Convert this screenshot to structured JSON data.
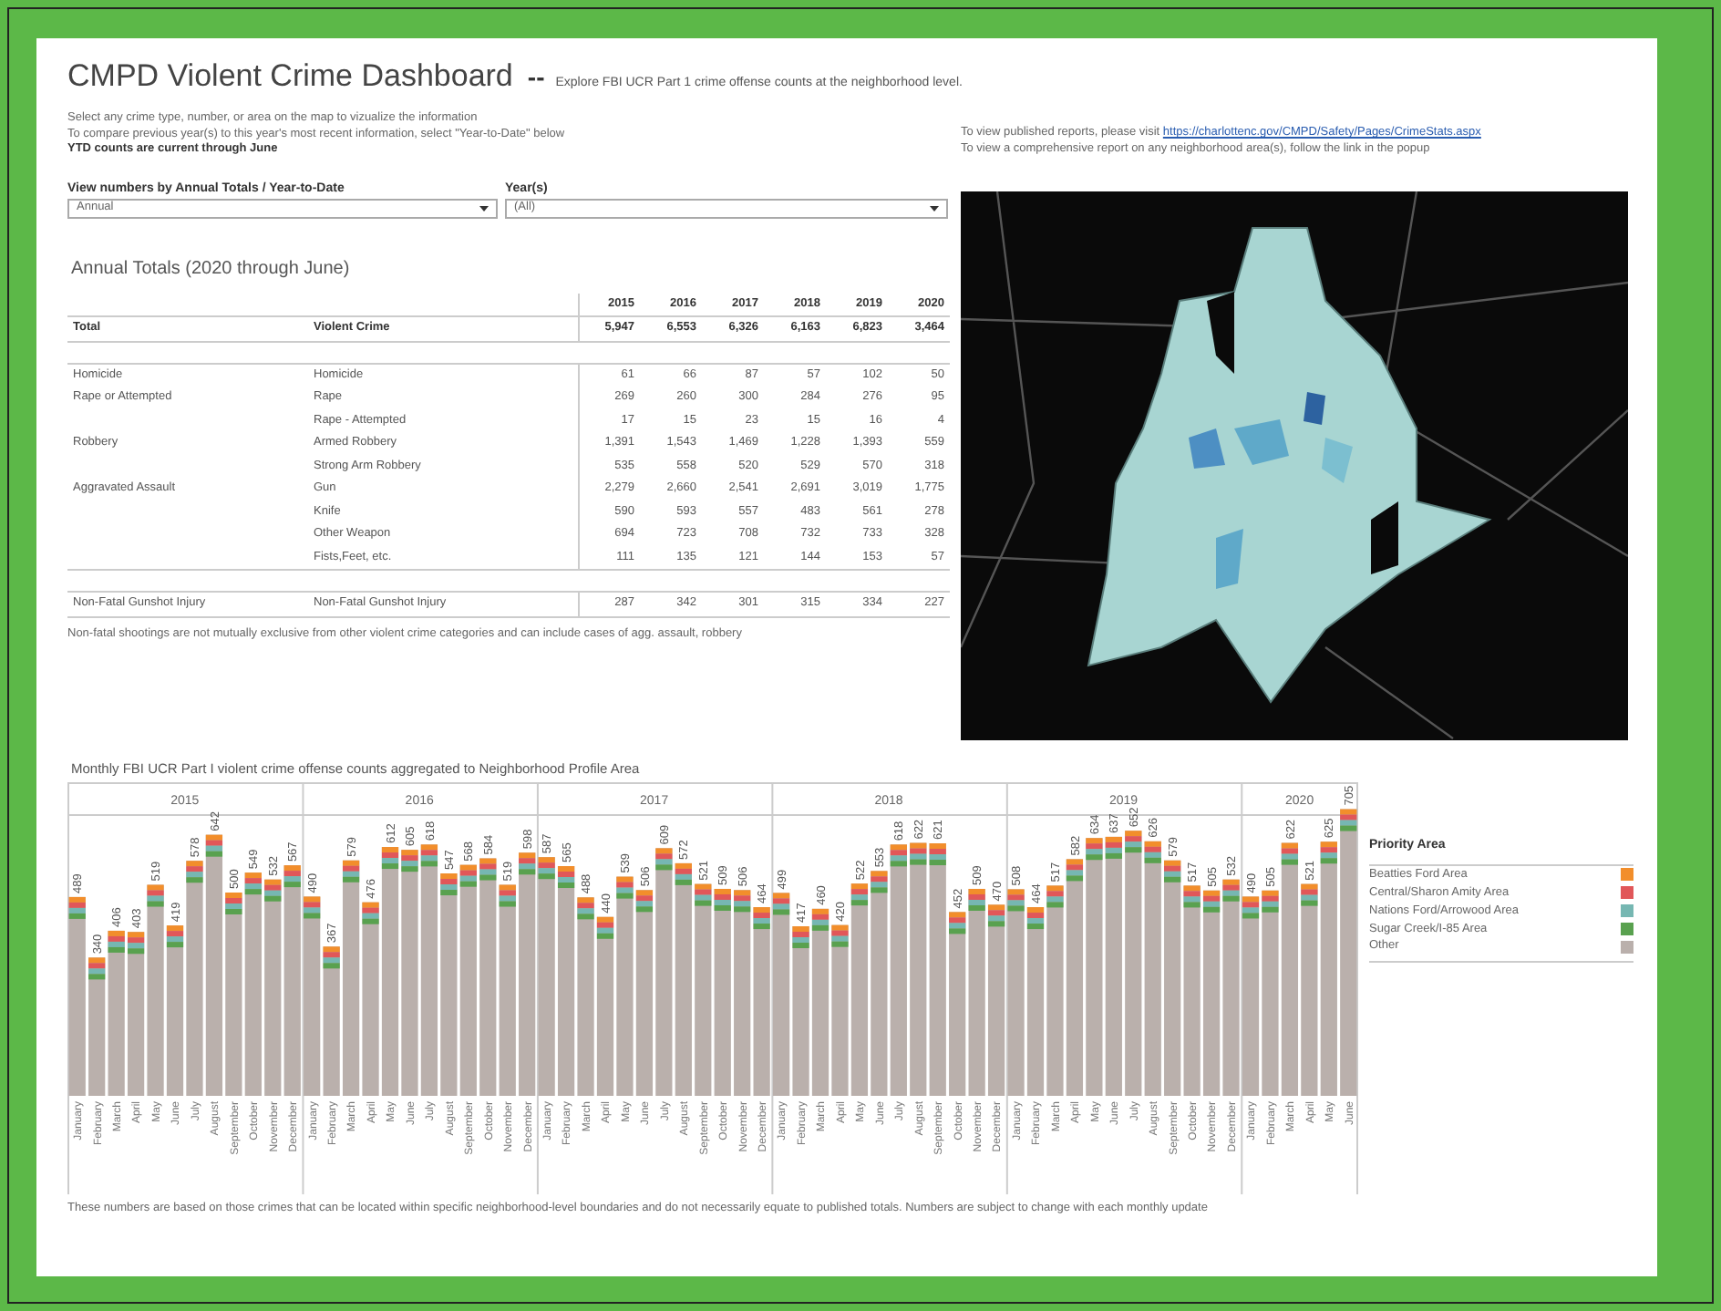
{
  "header": {
    "title": "CMPD Violent Crime Dashboard",
    "separator": "--",
    "subtitle": "Explore FBI UCR Part 1 crime offense counts at the neighborhood level."
  },
  "info_lines": [
    "Select any crime type, number, or area on the map to vizualize the information",
    "To compare previous year(s) to this year's most recent information, select \"Year-to-Date\" below"
  ],
  "ytd_note": "YTD counts are current through June",
  "filters": [
    {
      "label": "View numbers by Annual Totals / Year-to-Date",
      "value": "Annual"
    },
    {
      "label": "Year(s)",
      "value": "(All)"
    }
  ],
  "reports": {
    "text": "To view published reports, please visit",
    "link": "https://charlottenc.gov/CMPD/Safety/Pages/CrimeStats.aspx",
    "popup_note": "To view a comprehensive report on any neighborhood area(s), follow the link in the popup"
  },
  "table": {
    "title": "Annual Totals (2020 through June)",
    "columns": [
      "2015",
      "2016",
      "2017",
      "2018",
      "2019",
      "2020"
    ],
    "sections": [
      {
        "rows": [
          {
            "kind": "total",
            "category": "Total",
            "type": "Violent Crime",
            "values": [
              "5,947",
              "6,553",
              "6,326",
              "6,163",
              "6,823",
              "3,464"
            ]
          }
        ]
      },
      {
        "rows": [
          {
            "kind": "detail",
            "category": "Homicide",
            "type": "Homicide",
            "values": [
              "61",
              "66",
              "87",
              "57",
              "102",
              "50"
            ]
          },
          {
            "kind": "detail",
            "category": "Rape or Attempted",
            "type": "Rape",
            "values": [
              "269",
              "260",
              "300",
              "284",
              "276",
              "95"
            ]
          },
          {
            "kind": "detail",
            "type": "Rape - Attempted",
            "values": [
              "17",
              "15",
              "23",
              "15",
              "16",
              "4"
            ]
          },
          {
            "kind": "detail",
            "category": "Robbery",
            "type": "Armed Robbery",
            "values": [
              "1,391",
              "1,543",
              "1,469",
              "1,228",
              "1,393",
              "559"
            ]
          },
          {
            "kind": "detail",
            "type": "Strong Arm Robbery",
            "values": [
              "535",
              "558",
              "520",
              "529",
              "570",
              "318"
            ]
          },
          {
            "kind": "detail",
            "category": "Aggravated Assault",
            "type": "Gun",
            "values": [
              "2,279",
              "2,660",
              "2,541",
              "2,691",
              "3,019",
              "1,775"
            ]
          },
          {
            "kind": "detail",
            "type": "Knife",
            "values": [
              "590",
              "593",
              "557",
              "483",
              "561",
              "278"
            ]
          },
          {
            "kind": "detail",
            "type": "Other Weapon",
            "values": [
              "694",
              "723",
              "708",
              "732",
              "733",
              "328"
            ]
          },
          {
            "kind": "detail",
            "type": "Fists,Feet, etc.",
            "values": [
              "111",
              "135",
              "121",
              "144",
              "153",
              "57"
            ]
          }
        ]
      },
      {
        "rows": [
          {
            "kind": "detail",
            "category": "Non-Fatal Gunshot Injury",
            "type": "Non-Fatal Gunshot Injury",
            "values": [
              "287",
              "342",
              "301",
              "315",
              "334",
              "227"
            ]
          }
        ]
      }
    ],
    "footnote": "Non-fatal shootings are not mutually exclusive from other violent crime categories and can include cases of agg. assault, robbery"
  },
  "chart": {
    "title": "Monthly FBI UCR Part I violent crime offense counts aggregated to Neighborhood Profile Area",
    "year_headers": [
      "2015",
      "2016",
      "2017",
      "2018",
      "2019",
      "2020"
    ],
    "chart_data": {
      "type": "bar",
      "stacked": true,
      "data_labels": true,
      "categories": [
        "January",
        "February",
        "March",
        "April",
        "May",
        "June",
        "July",
        "August",
        "September",
        "October",
        "November",
        "December",
        "January",
        "February",
        "March",
        "April",
        "May",
        "June",
        "July",
        "August",
        "September",
        "October",
        "November",
        "December",
        "January",
        "February",
        "March",
        "April",
        "May",
        "June",
        "July",
        "August",
        "September",
        "October",
        "November",
        "December",
        "January",
        "February",
        "March",
        "April",
        "May",
        "June",
        "July",
        "August",
        "September",
        "October",
        "November",
        "December",
        "January",
        "February",
        "March",
        "April",
        "May",
        "June",
        "July",
        "August",
        "September",
        "October",
        "November",
        "December",
        "January",
        "February",
        "March",
        "April",
        "May",
        "June"
      ],
      "values": [
        489,
        340,
        406,
        403,
        519,
        419,
        578,
        642,
        500,
        549,
        532,
        567,
        490,
        367,
        579,
        476,
        612,
        605,
        618,
        547,
        568,
        584,
        519,
        598,
        587,
        565,
        488,
        440,
        539,
        506,
        609,
        572,
        521,
        509,
        506,
        464,
        499,
        417,
        460,
        420,
        522,
        553,
        618,
        622,
        621,
        452,
        509,
        470,
        508,
        464,
        517,
        582,
        634,
        637,
        652,
        626,
        579,
        517,
        505,
        532,
        490,
        505,
        622,
        521,
        625,
        705
      ]
    },
    "legend": {
      "title": "Priority Area",
      "items": [
        {
          "label": "Beatties Ford Area",
          "color": "#f28e2b"
        },
        {
          "label": "Central/Sharon Amity Area",
          "color": "#e15759"
        },
        {
          "label": "Nations Ford/Arrowood Area",
          "color": "#76b7b2"
        },
        {
          "label": "Sugar Creek/I-85 Area",
          "color": "#59a14f"
        },
        {
          "label": "Other",
          "color": "#bab0ac"
        }
      ]
    }
  },
  "footnote": "These numbers are based on those crimes that can be located within specific neighborhood-level boundaries and do not necessarily equate to published totals. Numbers are subject to change with each monthly update"
}
